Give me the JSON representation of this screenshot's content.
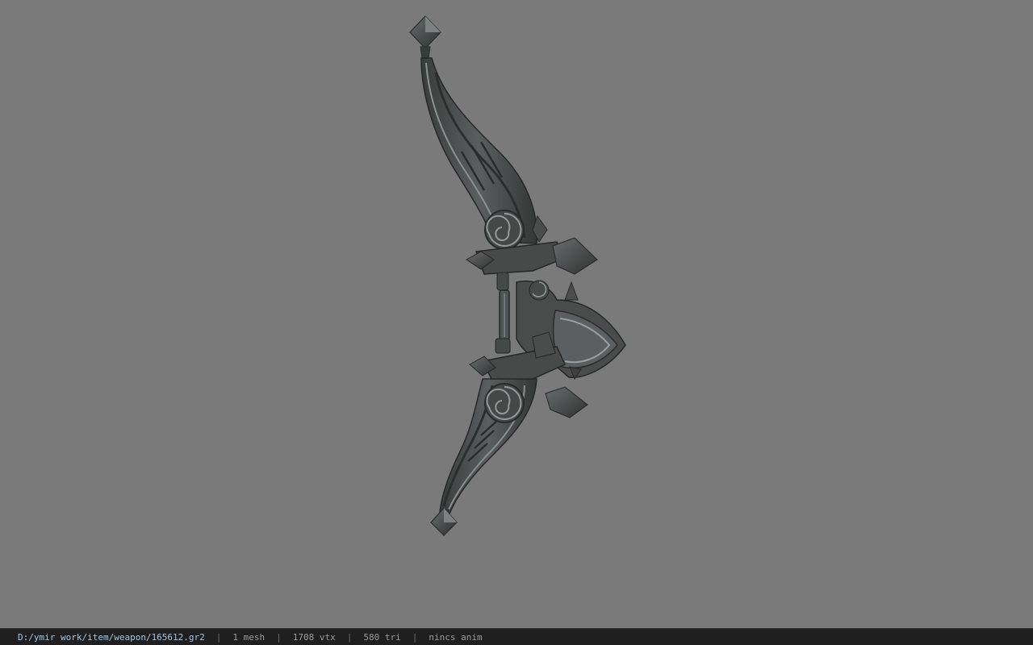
{
  "status_bar": {
    "file_path": "D:/ymir work/item/weapon/165612.gr2",
    "sep": "|",
    "mesh_count": "1 mesh",
    "vertex_count": "1708 vtx",
    "triangle_count": "580 tri",
    "animation": "nincs anim"
  },
  "colors": {
    "viewport_background": "#7a7a7a",
    "model_base": "#4b4d4d",
    "model_dark": "#2f3131",
    "model_highlight": "#9aa0a0",
    "status_background": "#1f1f1f",
    "path_text": "#9fc6e0",
    "info_text": "#9a9a9a"
  }
}
